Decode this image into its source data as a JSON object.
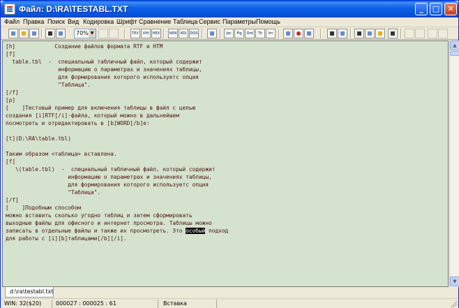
{
  "window": {
    "title": "Файл: D:\\RA\\TESTABL.TXT",
    "minimize_glyph": "_",
    "maximize_glyph": "□",
    "close_glyph": "✕"
  },
  "menu": [
    "Файл",
    "Правка",
    "Поиск",
    "Вид",
    "Кодировка",
    "Шрифт",
    "Сравнение",
    "Таблица",
    "Сервис",
    "Параметры",
    "Помощь"
  ],
  "toolbar": {
    "zoom": "70%",
    "zoom_arrow": "▼",
    "format_buttons": [
      "TEX",
      "VIH",
      "HEX",
      "WIN",
      "KOI",
      "DOS"
    ],
    "style_buttons": [
      "Jec",
      "Fig",
      "Ord",
      "Tir",
      "Irn"
    ]
  },
  "editor": {
    "lines": [
      "[h]            Создание файлов формата RTF и HTM",
      "[f]",
      "  table.tbl  -  специальный табличный файл, который содержит",
      "                информацию о параметрах и значениях таблицы,",
      "                для формирования которого используетс опция",
      "                \"Таблица\".",
      "[/f]",
      "[p]",
      "[    ]Тестовый пример для включения таблицы в файл с целью",
      "создания [i]RTF[/i]-файла, который можно в дальнейшем",
      "посмотреть и отредактировать в [b]WORD[/b]e:",
      "",
      "[t](D:\\RA\\table.tbl)",
      "",
      "Таким образом <таблица> вставлена.",
      "[f]",
      "   \\(table.tbl)  -  специальный табличный файл, который содержит",
      "                   информацию о параметрах и значениях таблицы,",
      "                   для формирования которого используетс опция",
      "                   \"Таблица\".",
      "[/f]",
      "[    ]Подобным способом",
      "можно вставить сколько угодно таблиц и затем сформировать",
      "выходные файлы для офисного и интернет просмотра. Таблицы можно",
      "записать в отдельные файлы и также их просмотреть. Это ",
      "для работы с [i][b]таблицами[/b][/i]."
    ],
    "highlight_line_tail": " подход",
    "highlighted_word": "особый"
  },
  "scrollbar": {
    "up": "▲",
    "down": "▼"
  },
  "tabs": {
    "active_file": "d:\\ra\\testabl.txt"
  },
  "status": {
    "encoding": "WIN: 32($20)",
    "position": "000027 : 000025 : 61",
    "mode": "Вставка"
  }
}
